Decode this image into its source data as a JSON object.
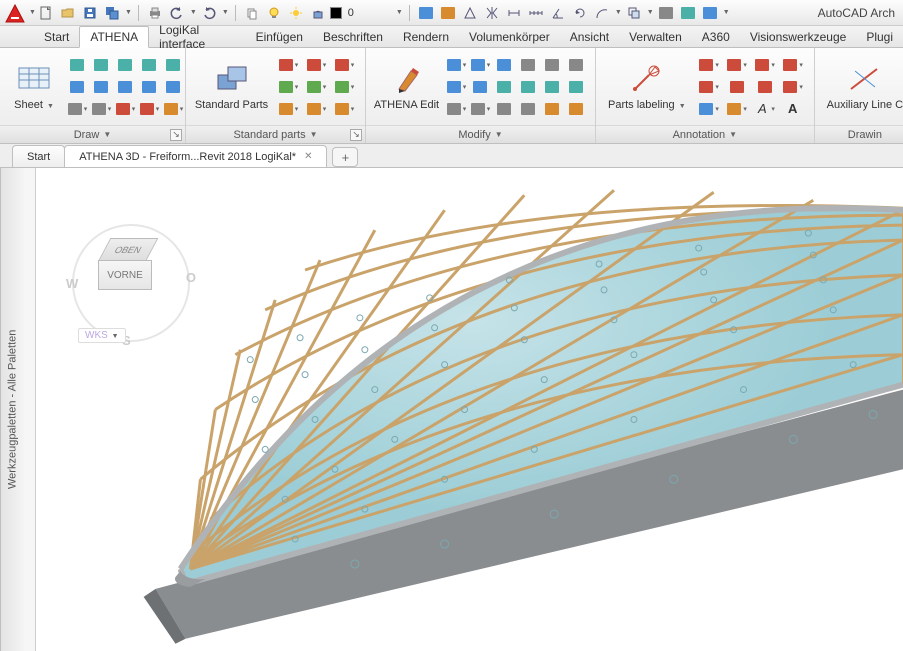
{
  "app_title": "AutoCAD Arch",
  "qat": {
    "layer_dropdown": "0"
  },
  "menu": {
    "items": [
      "Start",
      "ATHENA",
      "LogiKal interface",
      "Einfügen",
      "Beschriften",
      "Rendern",
      "Volumenkörper",
      "Ansicht",
      "Verwalten",
      "A360",
      "Visionswerkzeuge",
      "Plugi"
    ],
    "active_index": 1
  },
  "ribbon": {
    "panels": [
      {
        "title": "Draw",
        "has_dd": true,
        "has_exp": true,
        "big": {
          "label": "Sheet",
          "has_dd": true
        }
      },
      {
        "title": "Standard parts",
        "has_dd": true,
        "has_exp": true,
        "big": {
          "label": "Standard Parts"
        }
      },
      {
        "title": "Modify",
        "has_dd": true,
        "has_exp": false,
        "big": {
          "label": "ATHENA Edit"
        }
      },
      {
        "title": "Annotation",
        "has_dd": true,
        "has_exp": false,
        "big": {
          "label": "Parts labeling",
          "has_dd": true
        }
      },
      {
        "title": "Drawin",
        "has_dd": false,
        "has_exp": false,
        "big": {
          "label": "Auxiliary Line C"
        }
      }
    ]
  },
  "doc_tabs": {
    "tabs": [
      {
        "label": "Start",
        "closable": false,
        "active": false
      },
      {
        "label": "ATHENA 3D - Freiform...Revit 2018 LogiKal*",
        "closable": true,
        "active": true
      }
    ]
  },
  "side_palette": "Werkzeugpaletten - Alle Paletten",
  "viewcube": {
    "top": "OBEN",
    "front": "VORNE",
    "w": "W",
    "o": "O",
    "s": "S",
    "wks": "WKS"
  }
}
